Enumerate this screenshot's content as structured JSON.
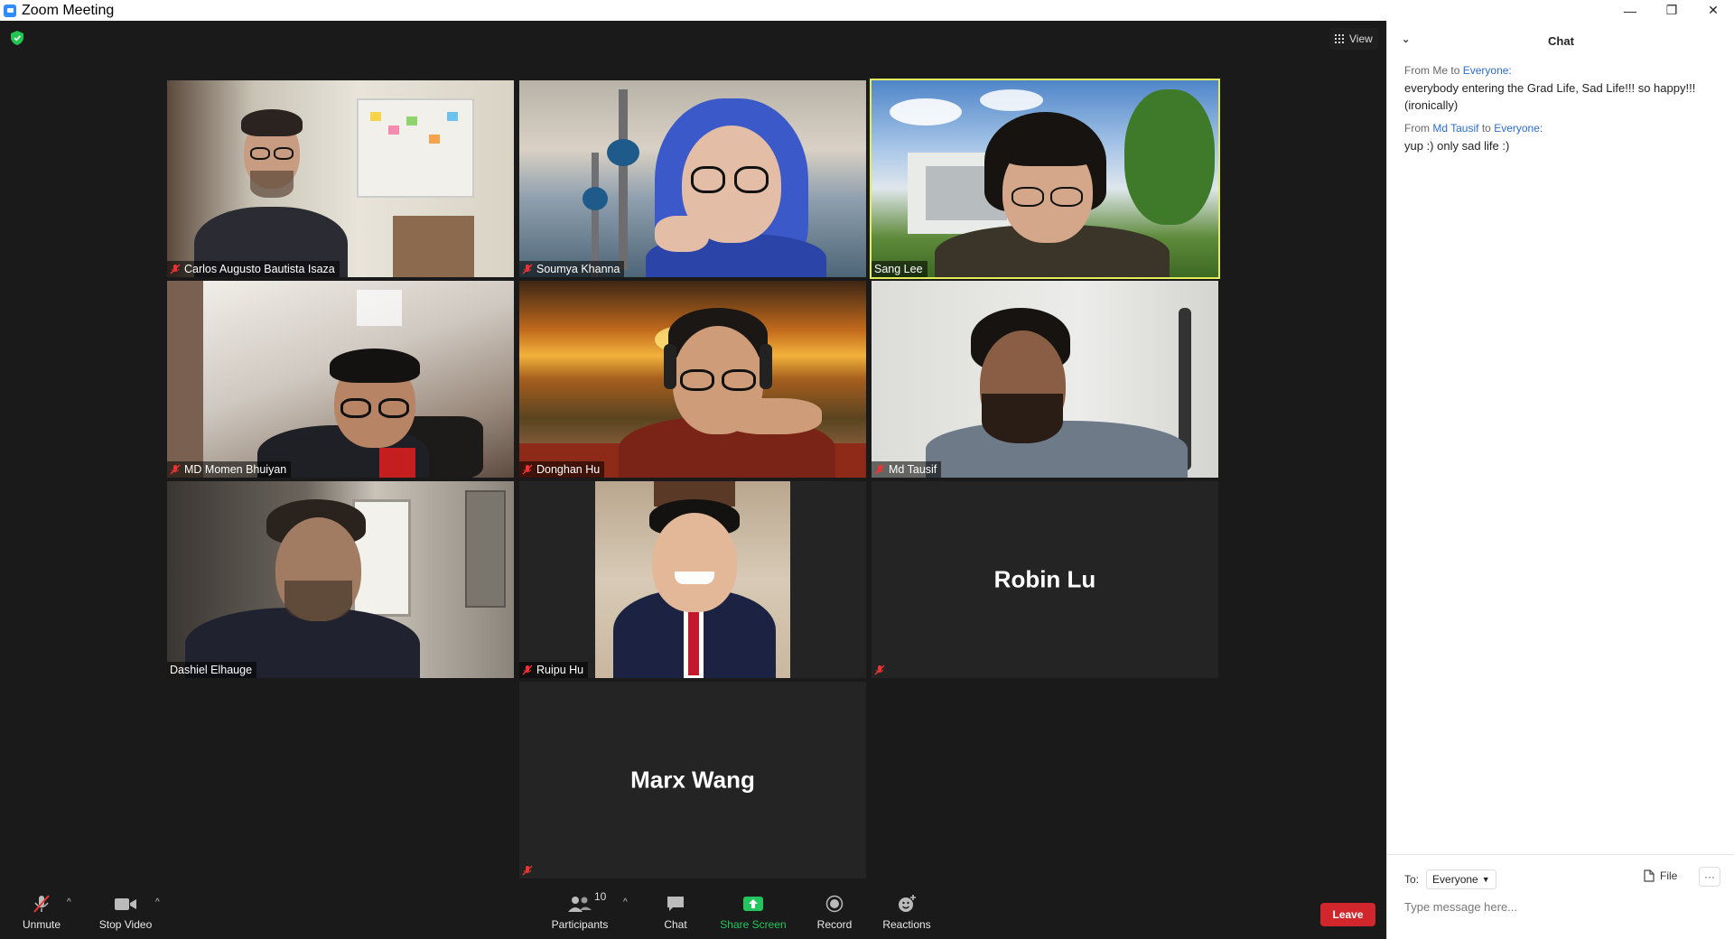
{
  "window": {
    "title": "Zoom Meeting",
    "minimize": "—",
    "restore": "❐",
    "close": "✕"
  },
  "view": {
    "label": "View"
  },
  "participants": [
    {
      "name": "Carlos Augusto Bautista Isaza",
      "muted": true,
      "video": true
    },
    {
      "name": "Soumya Khanna",
      "muted": true,
      "video": true
    },
    {
      "name": "Sang Lee",
      "muted": false,
      "video": true,
      "active_speaker": true
    },
    {
      "name": "MD Momen Bhuiyan",
      "muted": true,
      "video": true
    },
    {
      "name": "Donghan Hu",
      "muted": true,
      "video": true
    },
    {
      "name": "Md Tausif",
      "muted": true,
      "video": true
    },
    {
      "name": "Dashiel Elhauge",
      "muted": false,
      "video": true
    },
    {
      "name": "Ruipu Hu",
      "muted": true,
      "video": true
    },
    {
      "name": "Robin Lu",
      "muted": true,
      "video": false
    },
    {
      "name": "Marx Wang",
      "muted": true,
      "video": false
    }
  ],
  "toolbar": {
    "unmute": "Unmute",
    "stop_video": "Stop Video",
    "participants": "Participants",
    "participant_count": "10",
    "chat": "Chat",
    "share_screen": "Share Screen",
    "record": "Record",
    "reactions": "Reactions",
    "leave": "Leave"
  },
  "chat": {
    "title": "Chat",
    "messages": [
      {
        "from_prefix": "From",
        "sender": "Me",
        "to_word": "to",
        "recipient": "Everyone:",
        "text": "everybody entering the Grad Life, Sad Life!!! so happy!!! (ironically)"
      },
      {
        "from_prefix": "From",
        "sender": "Md Tausif",
        "to_word": "to",
        "recipient": "Everyone:",
        "text": "yup :) only sad life :)"
      }
    ],
    "to_label": "To:",
    "recipient_value": "Everyone",
    "file_label": "File",
    "more": "···",
    "input_placeholder": "Type message here..."
  },
  "colors": {
    "active_speaker_border": "#e3ee5a",
    "leave_red": "#d1262b",
    "share_green": "#22c55e",
    "link_blue": "#2d6ccc"
  }
}
